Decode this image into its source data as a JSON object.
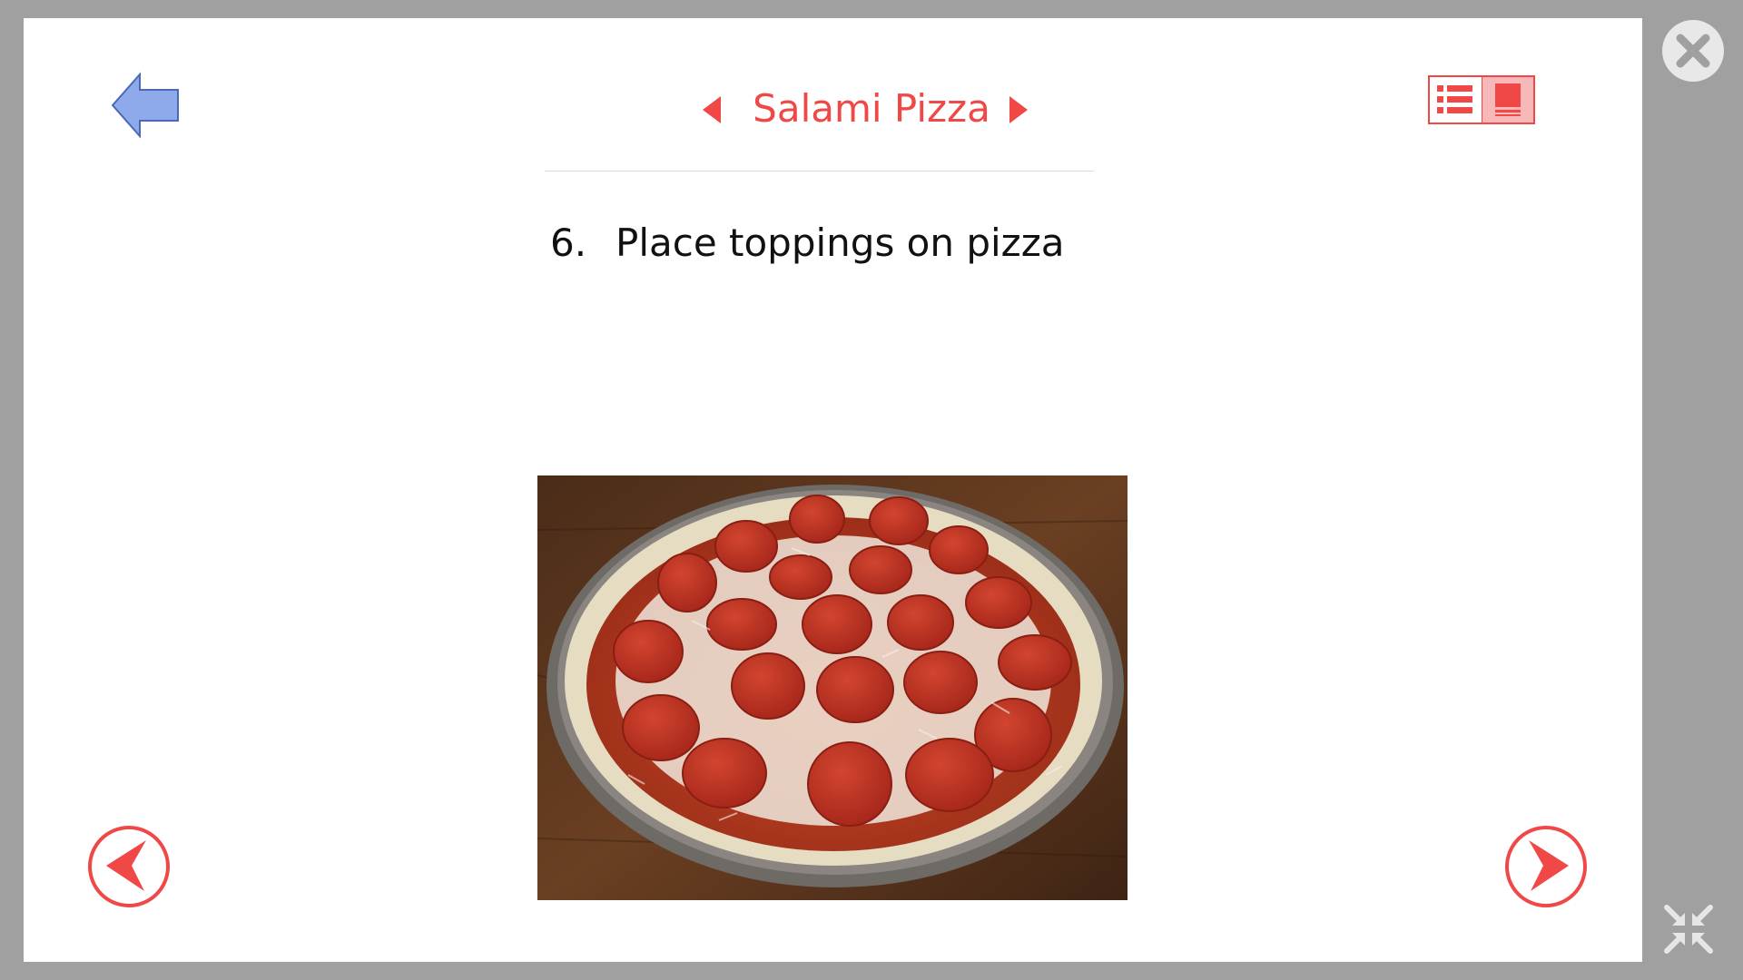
{
  "header": {
    "recipe_title": "Salami Pizza",
    "back_icon": "back-arrow-icon",
    "prev_recipe_icon": "caret-left-icon",
    "next_recipe_icon": "caret-right-icon"
  },
  "view_toggle": {
    "options": [
      "list-view-icon",
      "slide-view-icon"
    ],
    "active": "slide-view-icon"
  },
  "step": {
    "number": "6.",
    "text": "Place toppings on pizza"
  },
  "photo": {
    "subject": "pizza-topped-with-salami-icon"
  },
  "navigation": {
    "prev_icon": "circle-arrow-left-icon",
    "next_icon": "circle-arrow-right-icon"
  },
  "window": {
    "close_icon": "close-icon",
    "shrink_icon": "shrink-icon"
  },
  "colors": {
    "accent": "#f04747",
    "back_arrow_fill": "#8faaeb",
    "frame": "#a0a0a0",
    "toggle_active_bg": "#f6b8b8"
  }
}
